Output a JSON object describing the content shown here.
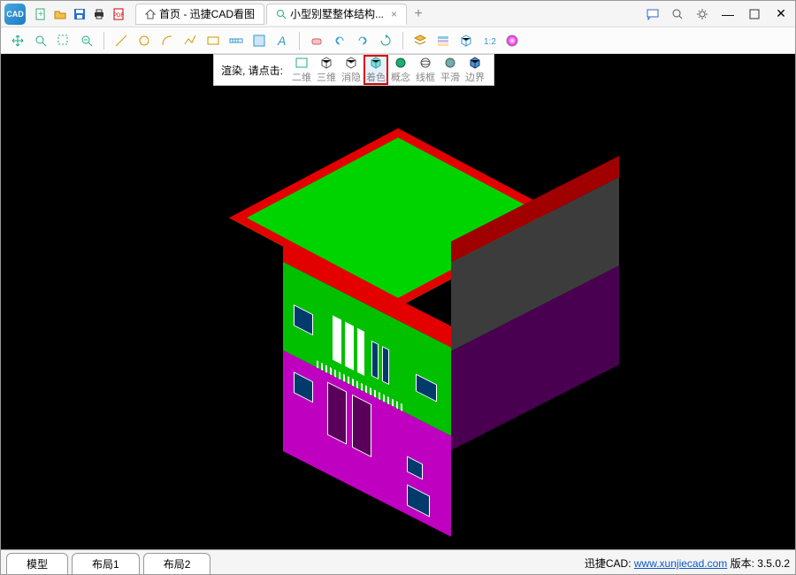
{
  "titlebar": {
    "tabs": [
      {
        "icon": "home-icon",
        "label": "首页 - 迅捷CAD看图",
        "closable": false
      },
      {
        "icon": "search-icon",
        "label": "小型别墅整体结构...",
        "closable": true,
        "active": true
      }
    ]
  },
  "render_popup": {
    "hint": "渲染, 请点击:",
    "options": [
      {
        "key": "2d",
        "label": "二维"
      },
      {
        "key": "3d",
        "label": "三维"
      },
      {
        "key": "hide",
        "label": "消隐"
      },
      {
        "key": "shade",
        "label": "着色",
        "selected": true
      },
      {
        "key": "concept",
        "label": "概念"
      },
      {
        "key": "wire",
        "label": "线框"
      },
      {
        "key": "smooth",
        "label": "平滑"
      },
      {
        "key": "edge",
        "label": "边界"
      }
    ]
  },
  "layout_tabs": [
    {
      "label": "模型",
      "active": true
    },
    {
      "label": "布局1"
    },
    {
      "label": "布局2"
    }
  ],
  "status": {
    "brand": "迅捷CAD:",
    "url_text": "www.xunjiecad.com",
    "version_label": "版本:",
    "version": "3.5.0.2"
  }
}
